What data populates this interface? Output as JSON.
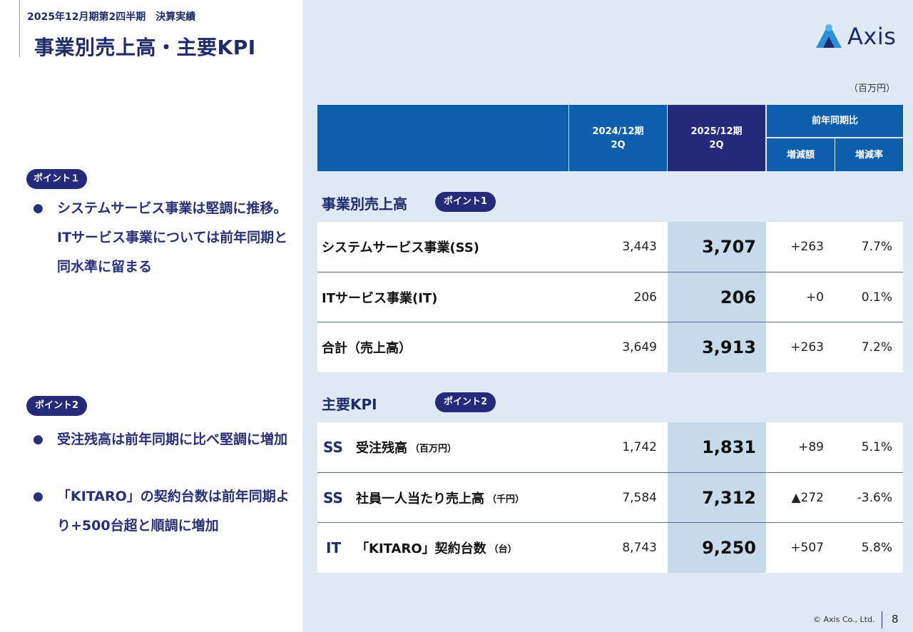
{
  "header": {
    "subtitle": "2025年12月期第2四半期　決算実績",
    "title": "事業別売上高・主要KPI"
  },
  "logo": {
    "text": "Axis"
  },
  "unit": "（百万円）",
  "left_panel": {
    "point1": {
      "badge": "ポイント１",
      "bullets": [
        "システムサービス事業は堅調に推移。ITサービス事業については前年同期と同水準に留まる"
      ]
    },
    "point2": {
      "badge": "ポイント2",
      "bullets": [
        "受注残高は前年同期に比べ堅調に増加",
        "「KITARO」の契約台数は前年同期より+500台超と順調に増加"
      ]
    }
  },
  "table": {
    "columns": {
      "prev": "2024/12期\n2Q",
      "cur": "2025/12期\n2Q",
      "yoy": "前年同期比",
      "diff": "増減額",
      "rate": "増減率"
    },
    "sales_section": {
      "label": "事業別売上高",
      "badge": "ポイント1",
      "rows": [
        {
          "name": "システムサービス事業(SS)",
          "prev": "3,443",
          "cur": "3,707",
          "diff": "+263",
          "rate": "7.7%"
        },
        {
          "name": "ITサービス事業(IT)",
          "prev": "206",
          "cur": "206",
          "diff": "+0",
          "rate": "0.1%"
        },
        {
          "name": "合計（売上高）",
          "prev": "3,649",
          "cur": "3,913",
          "diff": "+263",
          "rate": "7.2%"
        }
      ]
    },
    "kpi_section": {
      "label": "主要KPI",
      "badge": "ポイント2",
      "rows": [
        {
          "segment": "SS",
          "name": "受注残高",
          "unit": "（百万円）",
          "prev": "1,742",
          "cur": "1,831",
          "diff": "+89",
          "rate": "5.1%"
        },
        {
          "segment": "SS",
          "name": "社員一人当たり売上高",
          "unit": "（千円）",
          "prev": "7,584",
          "cur": "7,312",
          "diff": "▲272",
          "rate": "-3.6%"
        },
        {
          "segment": "IT",
          "name": "「KITARO」契約台数",
          "unit": "（台）",
          "prev": "8,743",
          "cur": "9,250",
          "diff": "+507",
          "rate": "5.8%"
        }
      ]
    }
  },
  "footer": {
    "copyright": "© Axis Co., Ltd.",
    "page": "8"
  },
  "colors": {
    "navy": "#1f2a6b",
    "header_blue": "#0f5eae",
    "header_dark": "#252b7a",
    "highlight": "#c6daec",
    "panel_bg": "#dfe9f4"
  }
}
